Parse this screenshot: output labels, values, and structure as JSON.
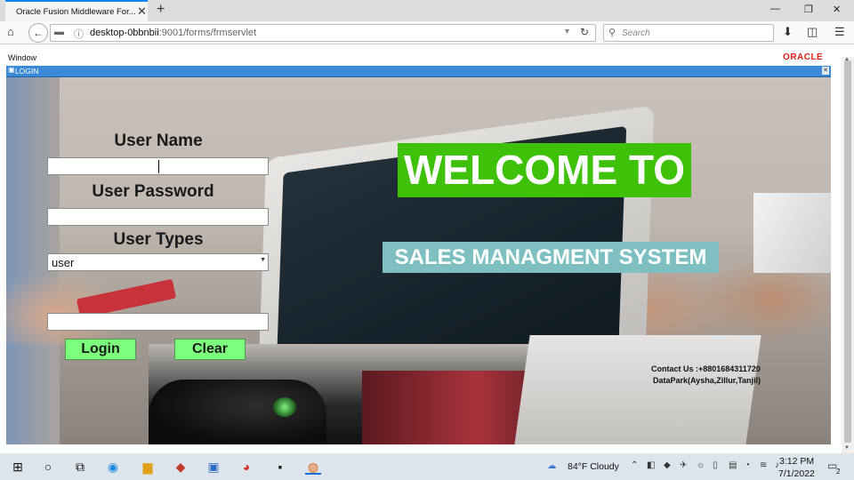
{
  "browser": {
    "tab_title": "Oracle Fusion Middleware For...",
    "url_host": "desktop-0bbnbii",
    "url_path": ":9001/forms/frmservlet",
    "search_placeholder": "Search"
  },
  "forms": {
    "menu_window": "Window",
    "oracle_logo": "ORACLE",
    "login_title": "LOGIN"
  },
  "login": {
    "username_label": "User Name",
    "username_value": "",
    "password_label": "User Password",
    "password_value": "",
    "usertype_label": "User Types",
    "usertype_value": "user",
    "extra_field_value": "",
    "login_button": "Login",
    "clear_button": "Clear"
  },
  "banner": {
    "welcome": "WELCOME TO",
    "system_name": "SALES MANAGMENT SYSTEM",
    "contact_line1": "Contact Us :+8801684311720",
    "contact_line2": "DataPark(Aysha,Zillur,Tanjil)"
  },
  "taskbar": {
    "weather": "84°F  Cloudy",
    "time": "3:12 PM",
    "date": "7/1/2022",
    "notification_count": "2"
  },
  "colors": {
    "welcome_bg": "#3fc10a",
    "system_bg": "#7ebfc1",
    "button_bg": "#7cff7c",
    "title_bar": "#3a8ad6"
  }
}
